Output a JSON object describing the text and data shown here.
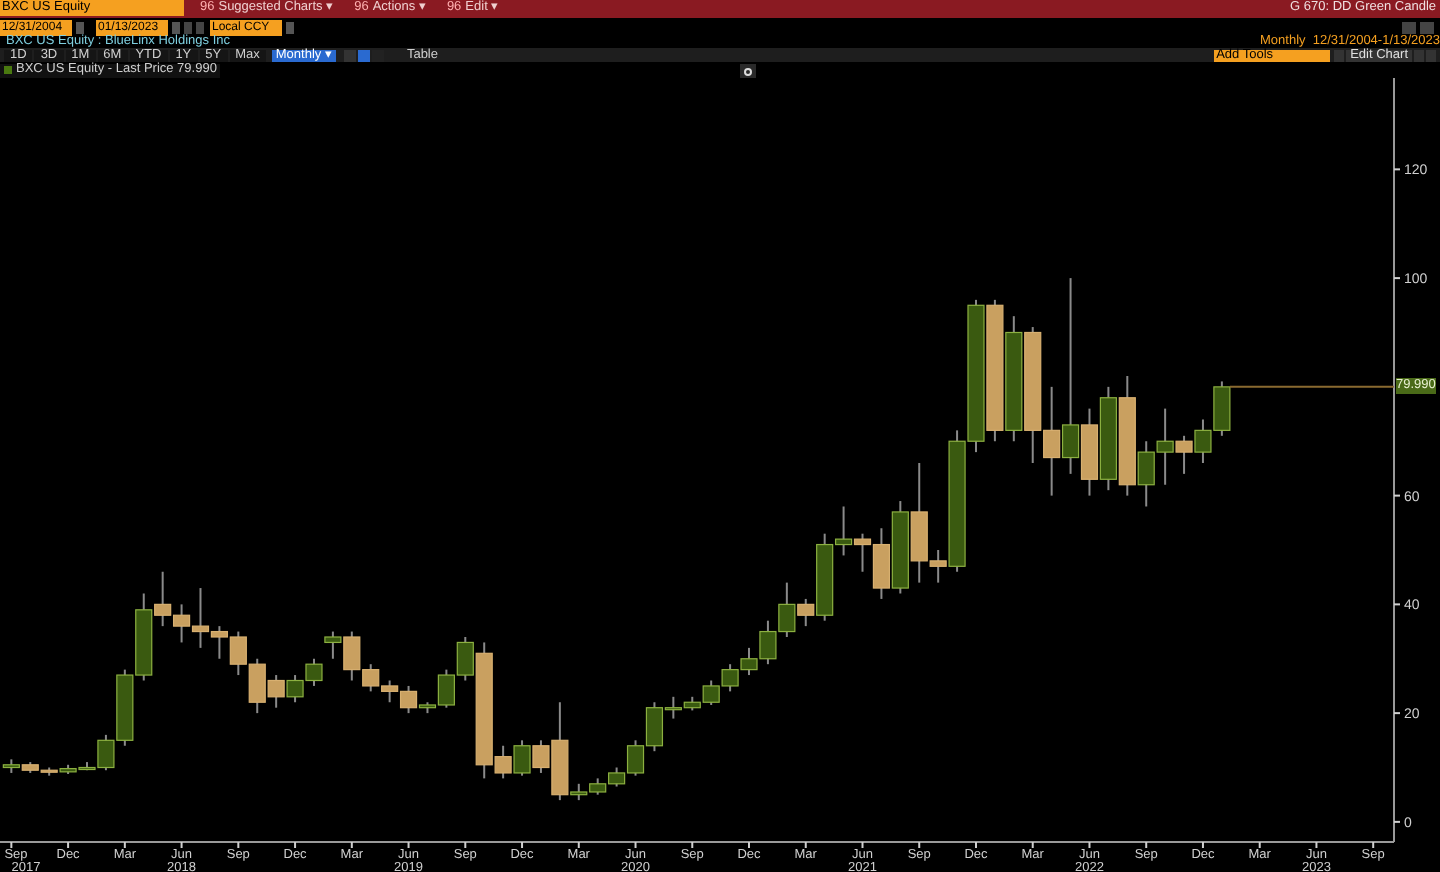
{
  "top_bar": {
    "security_field": "BXC US Equity",
    "menus": [
      {
        "icon": "96",
        "label": "Suggested Charts ▾"
      },
      {
        "icon": "96",
        "label": "Actions ▾"
      },
      {
        "icon": "96",
        "label": "Edit ▾"
      }
    ],
    "chart_name": "G 670: DD Green Candle"
  },
  "date_bar": {
    "start_date": "12/31/2004",
    "end_date": "01/13/2023",
    "currency": "Local CCY"
  },
  "security_title": "BXC US Equity : BlueLinx Holdings Inc",
  "range_label": "Monthly  12/31/2004-1/13/2023",
  "periods": [
    {
      "label": "1D",
      "selected": false
    },
    {
      "label": "3D",
      "selected": false
    },
    {
      "label": "1M",
      "selected": false
    },
    {
      "label": "6M",
      "selected": false
    },
    {
      "label": "YTD",
      "selected": false
    },
    {
      "label": "1Y",
      "selected": false
    },
    {
      "label": "5Y",
      "selected": false
    },
    {
      "label": "Max",
      "selected": false
    }
  ],
  "frequency": "Monthly ▾",
  "table_button": "Table",
  "add_tools": "Add Tools",
  "edit_chart": "Edit Chart",
  "legend": "BXC US Equity - Last Price 79.990",
  "last_price_tag": "79.990",
  "year_labels": [
    "2017",
    "2018",
    "2019",
    "2020",
    "2021",
    "2022",
    "2023"
  ],
  "chart_data": {
    "type": "candlestick",
    "ylim": [
      -3.7,
      136.8
    ],
    "yticks": [
      0,
      20,
      40,
      60,
      100,
      120
    ],
    "categories": [
      "Sep",
      null,
      null,
      "Dec",
      null,
      null,
      "Mar",
      null,
      null,
      "Jun",
      null,
      null,
      "Sep",
      null,
      null,
      "Dec",
      null,
      null,
      "Mar",
      null,
      null,
      "Jun",
      null,
      null,
      "Sep",
      null,
      null,
      "Dec",
      null,
      null,
      "Mar",
      null,
      null,
      "Jun",
      null,
      null,
      "Sep",
      null,
      null,
      "Dec",
      null,
      null,
      "Mar",
      null,
      null,
      "Jun",
      null,
      null,
      "Sep",
      null,
      null,
      "Dec",
      null,
      null,
      "Mar",
      null,
      null,
      "Jun",
      null,
      null,
      "Sep",
      null,
      null,
      "Dec",
      null,
      null,
      "Mar",
      null,
      null,
      "Jun",
      null,
      null,
      "Sep"
    ],
    "ohlc": [
      [
        10,
        11.5,
        9,
        10.5
      ],
      [
        10.5,
        11,
        9,
        9.5
      ],
      [
        9.5,
        10,
        8.5,
        9.2
      ],
      [
        9.2,
        10.5,
        8.8,
        9.8
      ],
      [
        9.8,
        11,
        9.5,
        10
      ],
      [
        10,
        16,
        9.5,
        15
      ],
      [
        15,
        28,
        14,
        27
      ],
      [
        27,
        42,
        26,
        39
      ],
      [
        40,
        46,
        36,
        38
      ],
      [
        38,
        40,
        33,
        36
      ],
      [
        36,
        43,
        32,
        35
      ],
      [
        35,
        36,
        30,
        34
      ],
      [
        34,
        35,
        27,
        29
      ],
      [
        29,
        30,
        20,
        22
      ],
      [
        26,
        27,
        21,
        23
      ],
      [
        23,
        27,
        22,
        26
      ],
      [
        26,
        30,
        25,
        29
      ],
      [
        33,
        35,
        30,
        34
      ],
      [
        34,
        35,
        26,
        28
      ],
      [
        28,
        29,
        24,
        25
      ],
      [
        25,
        26,
        22,
        24
      ],
      [
        24,
        25,
        20,
        21
      ],
      [
        21,
        22,
        20,
        21.5
      ],
      [
        21.5,
        28,
        21,
        27
      ],
      [
        27,
        34,
        26,
        33
      ],
      [
        31,
        33,
        8,
        10.5
      ],
      [
        12,
        14,
        8,
        9
      ],
      [
        9,
        15,
        8.5,
        14
      ],
      [
        14,
        15,
        9,
        10
      ],
      [
        15,
        22,
        4,
        5
      ],
      [
        5,
        7,
        4,
        5.5
      ],
      [
        5.5,
        8,
        5,
        7
      ],
      [
        7,
        10,
        6.5,
        9
      ],
      [
        9,
        15,
        8.5,
        14
      ],
      [
        14,
        22,
        13,
        21
      ],
      [
        21,
        23,
        19,
        21
      ],
      [
        21,
        23,
        20.5,
        22
      ],
      [
        22,
        26,
        21.5,
        25
      ],
      [
        25,
        29,
        24,
        28
      ],
      [
        28,
        32,
        27,
        30
      ],
      [
        30,
        37,
        29,
        35
      ],
      [
        35,
        44,
        34,
        40
      ],
      [
        40,
        41,
        36,
        38
      ],
      [
        38,
        53,
        37,
        51
      ],
      [
        51,
        58,
        49,
        52
      ],
      [
        52,
        53,
        46,
        51
      ],
      [
        51,
        54,
        41,
        43
      ],
      [
        43,
        59,
        42,
        57
      ],
      [
        57,
        66,
        44,
        48
      ],
      [
        48,
        50,
        44,
        47
      ],
      [
        47,
        72,
        46,
        70
      ],
      [
        70,
        96,
        68,
        95
      ],
      [
        95,
        96,
        70,
        72
      ],
      [
        72,
        93,
        70,
        90
      ],
      [
        90,
        91,
        66,
        72
      ],
      [
        72,
        80,
        60,
        67
      ],
      [
        67,
        100,
        64,
        73
      ],
      [
        73,
        76,
        60,
        63
      ],
      [
        63,
        80,
        61,
        78
      ],
      [
        78,
        82,
        60,
        62
      ],
      [
        62,
        70,
        58,
        68
      ],
      [
        68,
        76,
        62,
        70
      ],
      [
        70,
        71,
        64,
        68
      ],
      [
        68,
        74,
        66,
        72
      ],
      [
        72,
        81,
        71,
        80
      ],
      null,
      null,
      null,
      null,
      null,
      null,
      null,
      null
    ]
  }
}
